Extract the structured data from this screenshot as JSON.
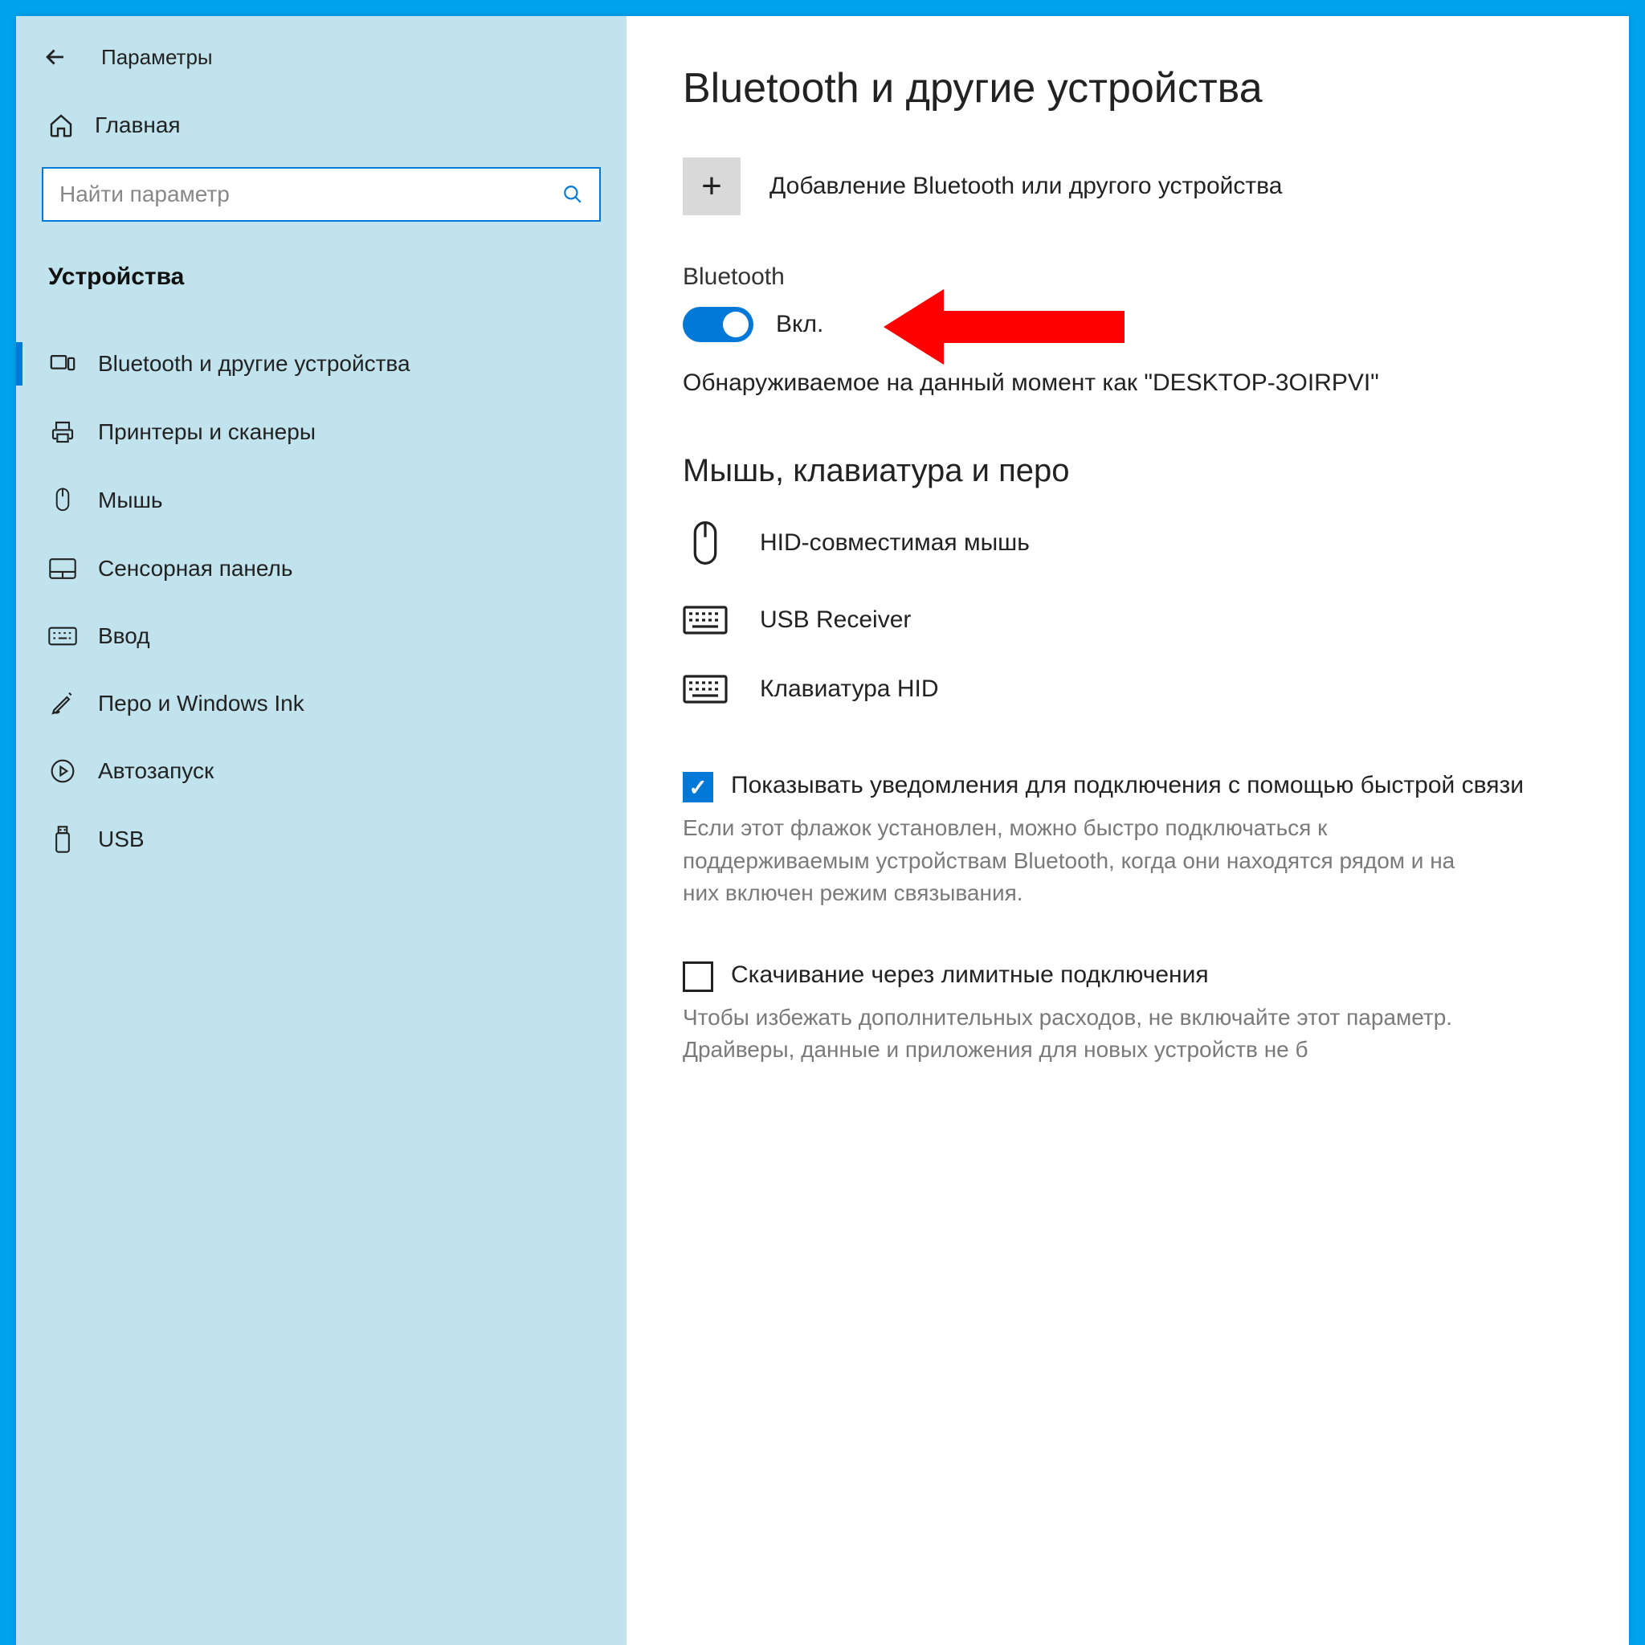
{
  "window": {
    "title": "Параметры"
  },
  "sidebar": {
    "home_label": "Главная",
    "search_placeholder": "Найти параметр",
    "category": "Устройства",
    "items": [
      {
        "label": "Bluetooth и другие устройства"
      },
      {
        "label": "Принтеры и сканеры"
      },
      {
        "label": "Мышь"
      },
      {
        "label": "Сенсорная панель"
      },
      {
        "label": "Ввод"
      },
      {
        "label": "Перо и Windows Ink"
      },
      {
        "label": "Автозапуск"
      },
      {
        "label": "USB"
      }
    ]
  },
  "main": {
    "title": "Bluetooth и другие устройства",
    "add_label": "Добавление Bluetooth или другого устройства",
    "bt_section": "Bluetooth",
    "bt_toggle": "Вкл.",
    "discoverable": "Обнаруживаемое на данный момент как \"DESKTOP-3OIRPVI\"",
    "devices_heading": "Мышь, клавиатура и перо",
    "devices": [
      {
        "label": "HID-совместимая мышь"
      },
      {
        "label": "USB Receiver"
      },
      {
        "label": "Клавиатура HID"
      }
    ],
    "swift_pair": {
      "label": "Показывать уведомления для подключения с помощью быстрой связи",
      "help": "Если этот флажок установлен, можно быстро подключаться к поддерживаемым устройствам Bluetooth, когда они находятся рядом и на них включен режим связывания."
    },
    "metered": {
      "label": "Скачивание через лимитные подключения",
      "help": "Чтобы избежать дополнительных расходов, не включайте этот параметр. Драйверы, данные и приложения для новых устройств не б"
    }
  }
}
